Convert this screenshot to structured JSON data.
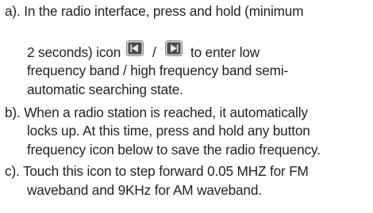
{
  "instructions": {
    "a": {
      "line1": "a). In the radio interface, press and hold (minimum",
      "line2_before_icons": "2 seconds) icon",
      "icon_separator": "/",
      "line2_after_icons": "to enter low",
      "line3": "frequency band / high frequency band semi-",
      "line4": "automatic searching state.",
      "icons": [
        "seek-back-icon",
        "seek-forward-icon"
      ]
    },
    "b": {
      "line1": "b). When a radio station is reached, it automatically",
      "line2": "locks up. At this time, press and hold any button",
      "line3": "frequency icon below to save the radio frequency."
    },
    "c": {
      "line1": "c). Touch this icon to step forward 0.05 MHZ for FM",
      "line2": "waveband and 9KHz for AM waveband."
    }
  },
  "colors": {
    "text": "#231f20",
    "icon_dark": "#3a3a3a",
    "icon_light": "#d9d9d9"
  }
}
